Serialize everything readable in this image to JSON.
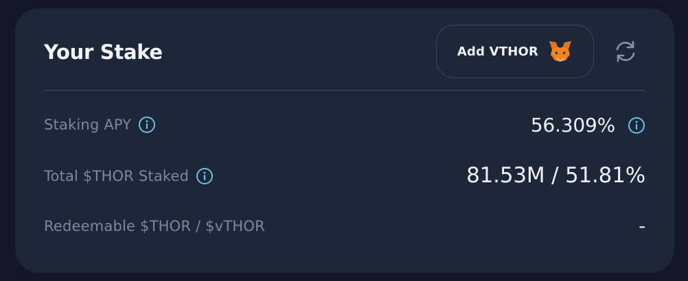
{
  "card": {
    "title": "Your Stake",
    "add_button_label": "Add VTHOR",
    "add_button_icon": "metamask-fox-icon",
    "refresh_icon": "refresh-icon"
  },
  "rows": [
    {
      "label": "Staking APY",
      "value": "56.309%",
      "has_info": true,
      "value_has_info": true
    },
    {
      "label": "Total $THOR Staked",
      "value": "81.53M / 51.81%",
      "has_info": true,
      "value_has_info": false
    },
    {
      "label": "Redeemable $THOR / $vTHOR",
      "value": "-",
      "has_info": false,
      "value_has_info": false
    }
  ],
  "colors": {
    "background": "#131726",
    "card": "#1d2737",
    "info_icon": "#6cc3e6",
    "label": "#7e879c",
    "value": "#eef1f6"
  }
}
